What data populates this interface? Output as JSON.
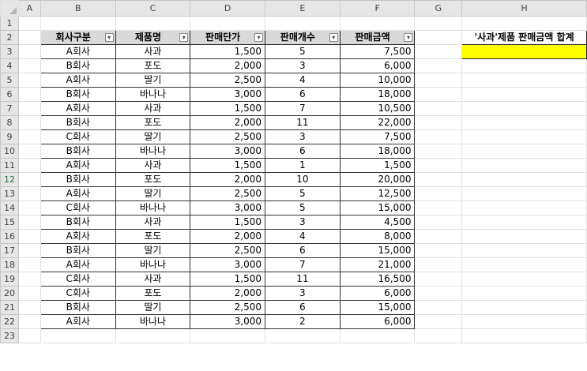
{
  "columns": [
    "A",
    "B",
    "C",
    "D",
    "E",
    "F",
    "G",
    "H"
  ],
  "table_headers": [
    "회사구분",
    "제품명",
    "판매단가",
    "판매개수",
    "판매금액"
  ],
  "rows": [
    [
      "A회사",
      "사과",
      "1,500",
      "5",
      "7,500"
    ],
    [
      "B회사",
      "포도",
      "2,000",
      "3",
      "6,000"
    ],
    [
      "A회사",
      "딸기",
      "2,500",
      "4",
      "10,000"
    ],
    [
      "B회사",
      "바나나",
      "3,000",
      "6",
      "18,000"
    ],
    [
      "A회사",
      "사과",
      "1,500",
      "7",
      "10,500"
    ],
    [
      "B회사",
      "포도",
      "2,000",
      "11",
      "22,000"
    ],
    [
      "C회사",
      "딸기",
      "2,500",
      "3",
      "7,500"
    ],
    [
      "B회사",
      "바나나",
      "3,000",
      "6",
      "18,000"
    ],
    [
      "A회사",
      "사과",
      "1,500",
      "1",
      "1,500"
    ],
    [
      "B회사",
      "포도",
      "2,000",
      "10",
      "20,000"
    ],
    [
      "A회사",
      "딸기",
      "2,500",
      "5",
      "12,500"
    ],
    [
      "C회사",
      "바나나",
      "3,000",
      "5",
      "15,000"
    ],
    [
      "B회사",
      "사과",
      "1,500",
      "3",
      "4,500"
    ],
    [
      "A회사",
      "포도",
      "2,000",
      "4",
      "8,000"
    ],
    [
      "B회사",
      "딸기",
      "2,500",
      "6",
      "15,000"
    ],
    [
      "A회사",
      "바나나",
      "3,000",
      "7",
      "21,000"
    ],
    [
      "C회사",
      "사과",
      "1,500",
      "11",
      "16,500"
    ],
    [
      "C회사",
      "포도",
      "2,000",
      "3",
      "6,000"
    ],
    [
      "B회사",
      "딸기",
      "2,500",
      "6",
      "15,000"
    ],
    [
      "A회사",
      "바나나",
      "3,000",
      "2",
      "6,000"
    ]
  ],
  "sum_label": "'사과'제품 판매금액 합계",
  "sum_value": "",
  "filter_icon": "dropdown-arrow-icon",
  "colors": {
    "header_fill": "#d9d9d9",
    "result_fill": "#ffff00",
    "selected_row_header": "#217346"
  }
}
